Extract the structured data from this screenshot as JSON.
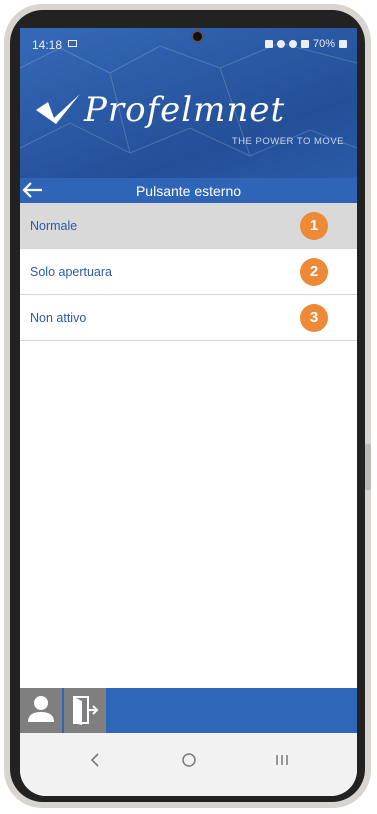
{
  "status_bar": {
    "time": "14:18",
    "battery": "70%"
  },
  "header": {
    "logo_text": "Profelmnet",
    "tagline": "THE POWER TO MOVE"
  },
  "toolbar": {
    "title": "Pulsante esterno"
  },
  "options": [
    {
      "label": "Normale",
      "badge": "1",
      "selected": true
    },
    {
      "label": "Solo apertuara",
      "badge": "2",
      "selected": false
    },
    {
      "label": "Non attivo",
      "badge": "3",
      "selected": false
    }
  ],
  "colors": {
    "primary": "#2f65b7",
    "accent": "#ee8a37",
    "label": "#2a5aa8",
    "selected_row": "#d9d9d9"
  },
  "icons": {
    "back": "arrow-left-icon",
    "user": "user-icon",
    "exit": "door-exit-icon",
    "nav_back": "chevron-left-icon",
    "nav_home": "circle-home-icon",
    "nav_recent": "recent-apps-icon"
  }
}
